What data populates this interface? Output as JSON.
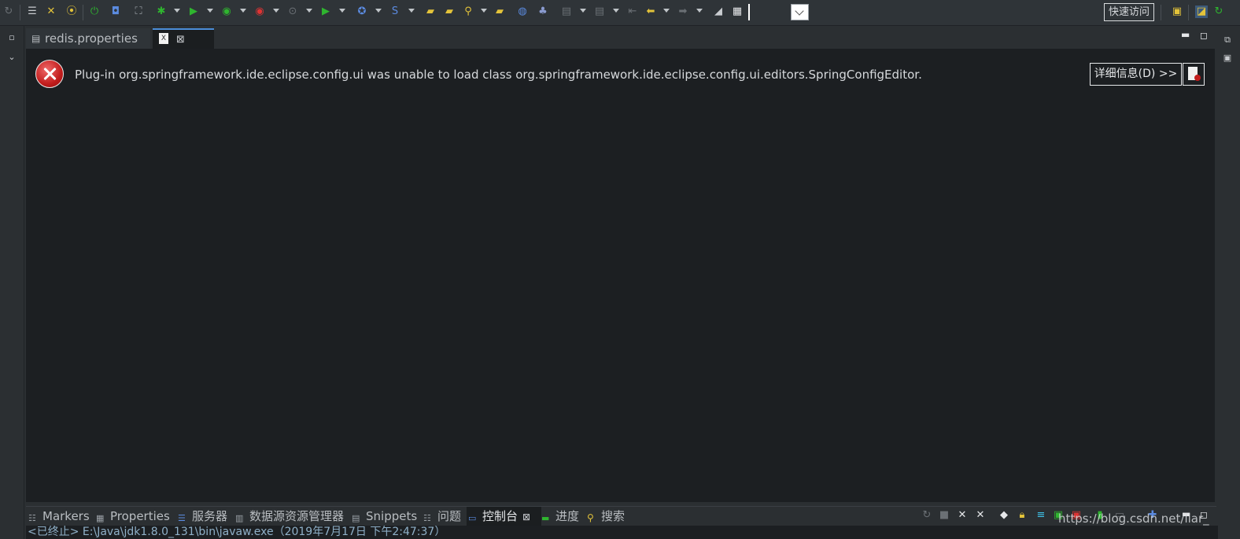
{
  "toolbar": {
    "quick_access": "快速访问"
  },
  "editor": {
    "tabs": [
      {
        "label": "redis.properties"
      },
      {
        "label": ""
      }
    ],
    "error_message": "Plug-in org.springframework.ide.eclipse.config.ui was unable to load class org.springframework.ide.eclipse.config.ui.editors.SpringConfigEditor.",
    "details_button": "详细信息(D) >>"
  },
  "bottom_panel": {
    "tabs": [
      {
        "label": "Markers"
      },
      {
        "label": "Properties"
      },
      {
        "label": "服务器"
      },
      {
        "label": "数据源资源管理器"
      },
      {
        "label": "Snippets"
      },
      {
        "label": "问题"
      },
      {
        "label": "控制台"
      },
      {
        "label": "进度"
      },
      {
        "label": "搜索"
      }
    ],
    "console_text": "<已终止> E:\\Java\\jdk1.8.0_131\\bin\\javaw.exe（2019年7月17日 下午2:47:37）"
  },
  "watermark": "https://blog.csdn.net/liar_",
  "colors": {
    "background": "#1c1f22",
    "toolbar": "#2f3438",
    "error_red": "#c21d1d",
    "active_tab_accent": "#4b8dd8",
    "green_run": "#2fb52f"
  }
}
